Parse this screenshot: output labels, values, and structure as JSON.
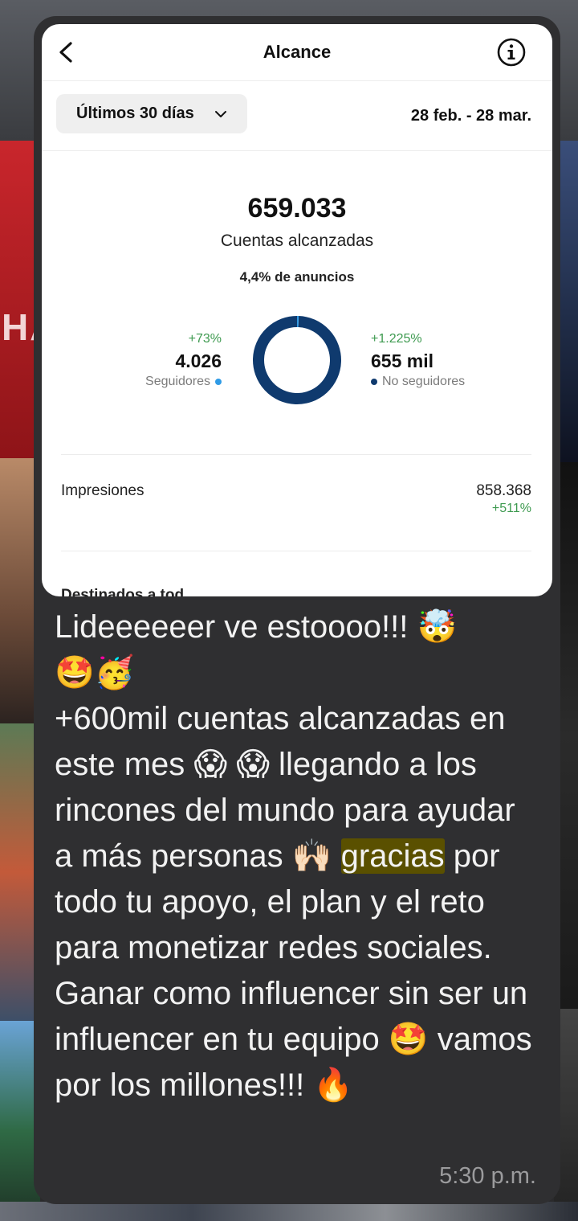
{
  "background": {
    "left_text": "HA"
  },
  "insight_card": {
    "title": "Alcance",
    "period_label": "Últimos 30 días",
    "date_range": "28 feb. - 28 mar.",
    "accounts_reached_value": "659.033",
    "accounts_reached_label": "Cuentas alcanzadas",
    "ads_share": "4,4% de anuncios",
    "followers": {
      "change": "+73%",
      "value": "4.026",
      "label": "Seguidores",
      "color": "#2f9be6"
    },
    "non_followers": {
      "change": "+1.225%",
      "value": "655 mil",
      "label": "No seguidores",
      "color": "#0f3a6e"
    },
    "donut": {
      "follower_fraction": 0.006
    },
    "impressions": {
      "label": "Impresiones",
      "value": "858.368",
      "change": "+511%"
    },
    "cut_off_text": "Destinados a tod..."
  },
  "message": {
    "line1": "Lideeeeeer ve estoooo!!! ",
    "emoji1": "🤯",
    "emoji2": "🤩",
    "emoji3": "🥳",
    "part2": "+600mil cuentas alcanzadas en este mes ",
    "emoji4": "😱",
    "emoji5": "😱",
    "part3": " llegando a los rincones del mundo para ayudar a más personas ",
    "emoji6": "🙌🏻",
    "highlight": "gracias",
    "part4": " por todo tu apoyo, el plan y el reto para monetizar redes sociales. Ganar como influencer sin ser un influencer en tu equipo ",
    "emoji7": "🤩",
    "part5": " vamos por los millones!!! ",
    "emoji8": "🔥",
    "timestamp": "5:30 p.m."
  },
  "colors": {
    "positive_change": "#3e9a50",
    "highlight": "#5a5000",
    "bubble": "#2f2f31"
  }
}
